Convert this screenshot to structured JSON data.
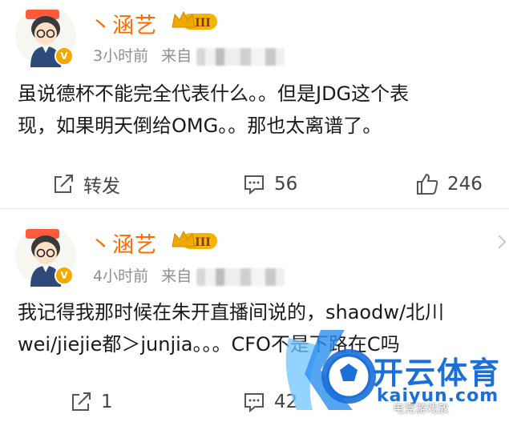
{
  "posts": [
    {
      "username": "丶涵艺",
      "level_badge": "III",
      "time": "3小时前",
      "source_prefix": "来自",
      "content_lines": [
        "虽说德杯不能完全代表什么。。但是JDG这个表",
        "现，如果明天倒给OMG。。那也太离谱了。"
      ],
      "actions": {
        "repost": "转发",
        "comment": "56",
        "like": "246"
      }
    },
    {
      "username": "丶涵艺",
      "level_badge": "III",
      "time": "4小时前",
      "source_prefix": "来自",
      "content_lines": [
        "我记得我那时候在朱开直播间说的，shaodw/北川",
        "wei/jiejie都＞junjia。。。CFO不是下路在C吗"
      ],
      "actions": {
        "repost": "1",
        "comment": "42",
        "like": ""
      }
    }
  ],
  "watermark": {
    "brand": "开云体育",
    "domain": "kaiyun.com",
    "source": "电竞游戏放"
  },
  "colors": {
    "username": "#ff6a00",
    "meta": "#8f8f8f",
    "badge": "#f6a700",
    "watermark": "#1b6fd9"
  }
}
